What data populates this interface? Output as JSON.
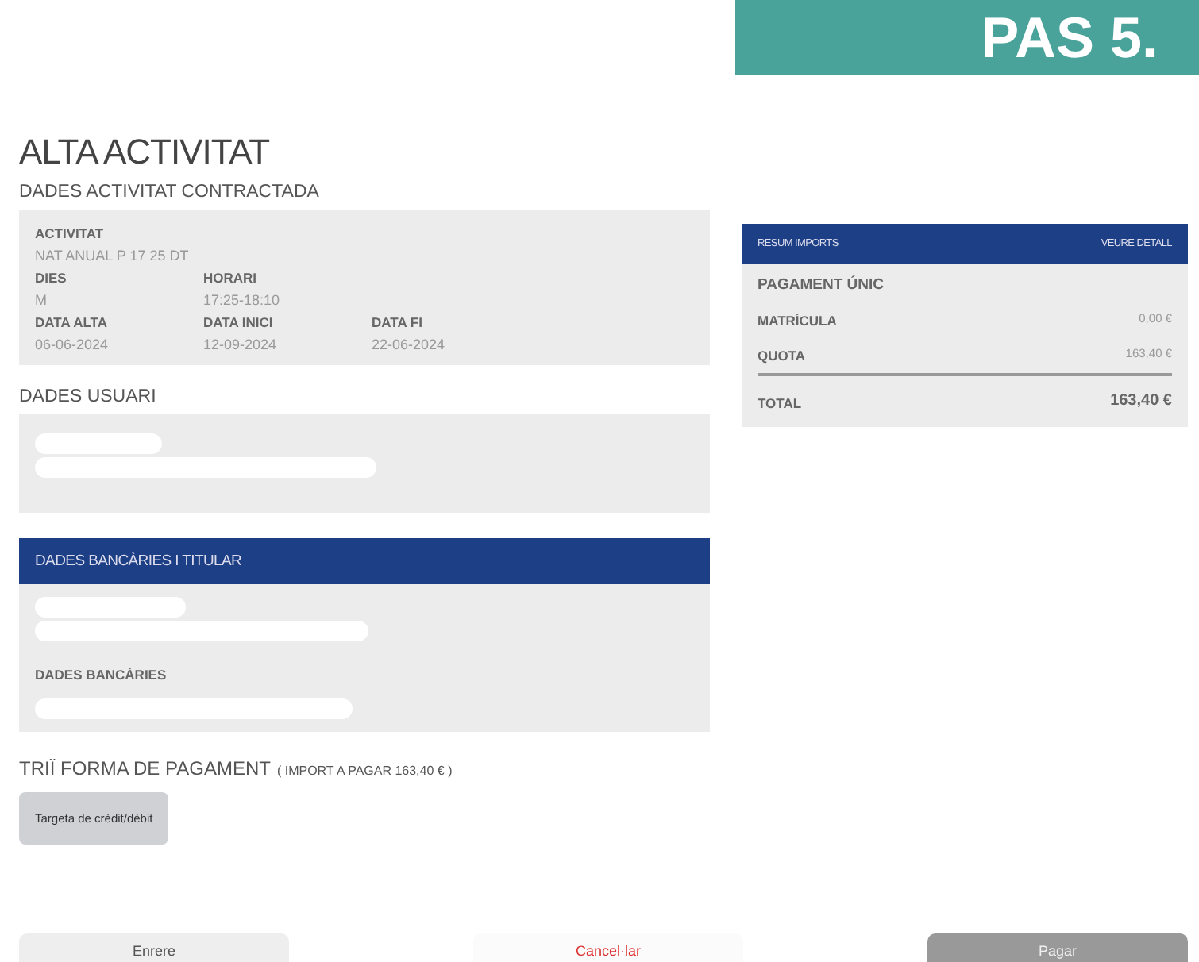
{
  "step_banner": "PAS 5.",
  "title": "ALTA ACTIVITAT",
  "activity_section": {
    "heading": "DADES ACTIVITAT CONTRACTADA",
    "rows": [
      [
        {
          "label": "ACTIVITAT",
          "value": "NAT ANUAL P 17 25 DT"
        }
      ],
      [
        {
          "label": "DIES",
          "value": "M"
        },
        {
          "label": "HORARI",
          "value": "17:25-18:10"
        }
      ],
      [
        {
          "label": "DATA ALTA",
          "value": "06-06-2024"
        },
        {
          "label": "DATA INICI",
          "value": "12-09-2024"
        },
        {
          "label": "DATA FI",
          "value": "22-06-2024"
        }
      ]
    ]
  },
  "user_section": {
    "heading": "DADES USUARI"
  },
  "bank_section": {
    "heading": "DADES BANCÀRIES I TITULAR",
    "subheading": "DADES BANCÀRIES"
  },
  "payment": {
    "heading": "TRIÏ FORMA DE PAGAMENT",
    "note": "( IMPORT A PAGAR 163,40 € )",
    "methods": [
      {
        "label": "Targeta de crèdit/dèbit",
        "selected": true
      }
    ]
  },
  "summary": {
    "heading": "RESUM IMPORTS",
    "link": "VEURE DETALL",
    "group": "PAGAMENT ÚNIC",
    "lines": [
      {
        "label": "MATRÍCULA",
        "amount": "0,00 €"
      },
      {
        "label": "QUOTA",
        "amount": "163,40 €"
      }
    ],
    "total": {
      "label": "TOTAL",
      "amount": "163,40 €"
    }
  },
  "buttons": [
    {
      "label": "Enrere",
      "kind": "back"
    },
    {
      "label": "Cancel·lar",
      "kind": "cancel"
    },
    {
      "label": "Pagar",
      "kind": "next"
    }
  ]
}
